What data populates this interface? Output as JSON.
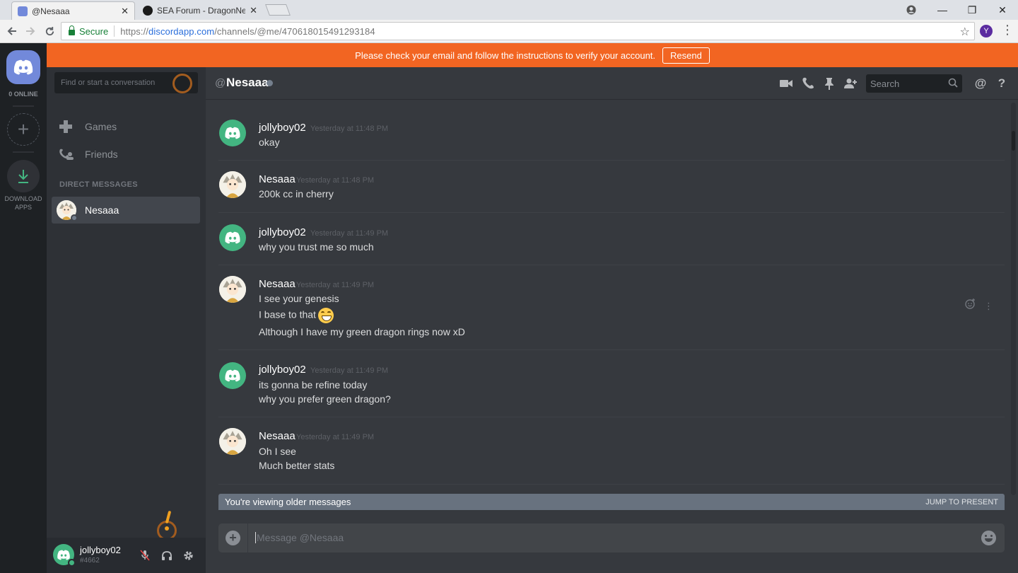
{
  "browser": {
    "tabs": [
      {
        "title": "@Nesaaa",
        "close": "✕",
        "favicon_color": "#7289da"
      },
      {
        "title": "SEA Forum - DragonNest",
        "close": "✕",
        "favicon_color": "#1a1a1a"
      }
    ],
    "secure_label": "Secure",
    "url_scheme": "https://",
    "url_host": "discordapp.com",
    "url_path": "/channels/@me/470618015491293184",
    "profile_initial": "Y",
    "window_controls": {
      "minimize": "—",
      "restore": "❐",
      "close": "✕"
    }
  },
  "banner": {
    "text": "Please check your email and follow the instructions to verify your account.",
    "button": "Resend",
    "color": "#f26522"
  },
  "guilds": {
    "online_label": "0 ONLINE",
    "add_server": "+",
    "download_label_1": "DOWNLOAD",
    "download_label_2": "APPS"
  },
  "sidebar": {
    "search_placeholder": "Find or start a conversation",
    "nav": [
      {
        "label": "Games",
        "icon": "gamepad-icon"
      },
      {
        "label": "Friends",
        "icon": "friends-icon"
      }
    ],
    "dm_header": "DIRECT MESSAGES",
    "dms": [
      {
        "name": "Nesaaa",
        "status": "offline"
      }
    ]
  },
  "user": {
    "name": "jollyboy02",
    "tag": "#4662",
    "status": "online"
  },
  "chat": {
    "at": "@",
    "channel_name": "Nesaaa",
    "search_placeholder": "Search",
    "mention_symbol": "@",
    "help_symbol": "?"
  },
  "messages": [
    {
      "author": "jollyboy02",
      "avatar": "discord",
      "timestamp": "Yesterday at 11:48 PM",
      "lines": [
        "okay"
      ]
    },
    {
      "author": "Nesaaa",
      "avatar": "user",
      "timestamp": "Yesterday at 11:48 PM",
      "lines": [
        "200k cc in cherry"
      ]
    },
    {
      "author": "jollyboy02",
      "avatar": "discord",
      "timestamp": "Yesterday at 11:49 PM",
      "lines": [
        "why you trust me so much"
      ]
    },
    {
      "author": "Nesaaa",
      "avatar": "user",
      "timestamp": "Yesterday at 11:49 PM",
      "lines": [
        "I see your genesis",
        "I base to that",
        "Although I have my green dragon rings now xD"
      ]
    },
    {
      "author": "jollyboy02",
      "avatar": "discord",
      "timestamp": "Yesterday at 11:49 PM",
      "lines": [
        "its gonna be refine today",
        "why you prefer green dragon?"
      ]
    },
    {
      "author": "Nesaaa",
      "avatar": "user",
      "timestamp": "Yesterday at 11:49 PM",
      "lines": [
        "Oh I see",
        "Much better stats"
      ]
    }
  ],
  "older_bar": {
    "text": "You're viewing older messages",
    "jump": "JUMP TO PRESENT"
  },
  "composer": {
    "placeholder": "Message @Nesaaa"
  },
  "colors": {
    "blurple": "#7289da",
    "green": "#43b581",
    "offline": "#747f8d"
  }
}
